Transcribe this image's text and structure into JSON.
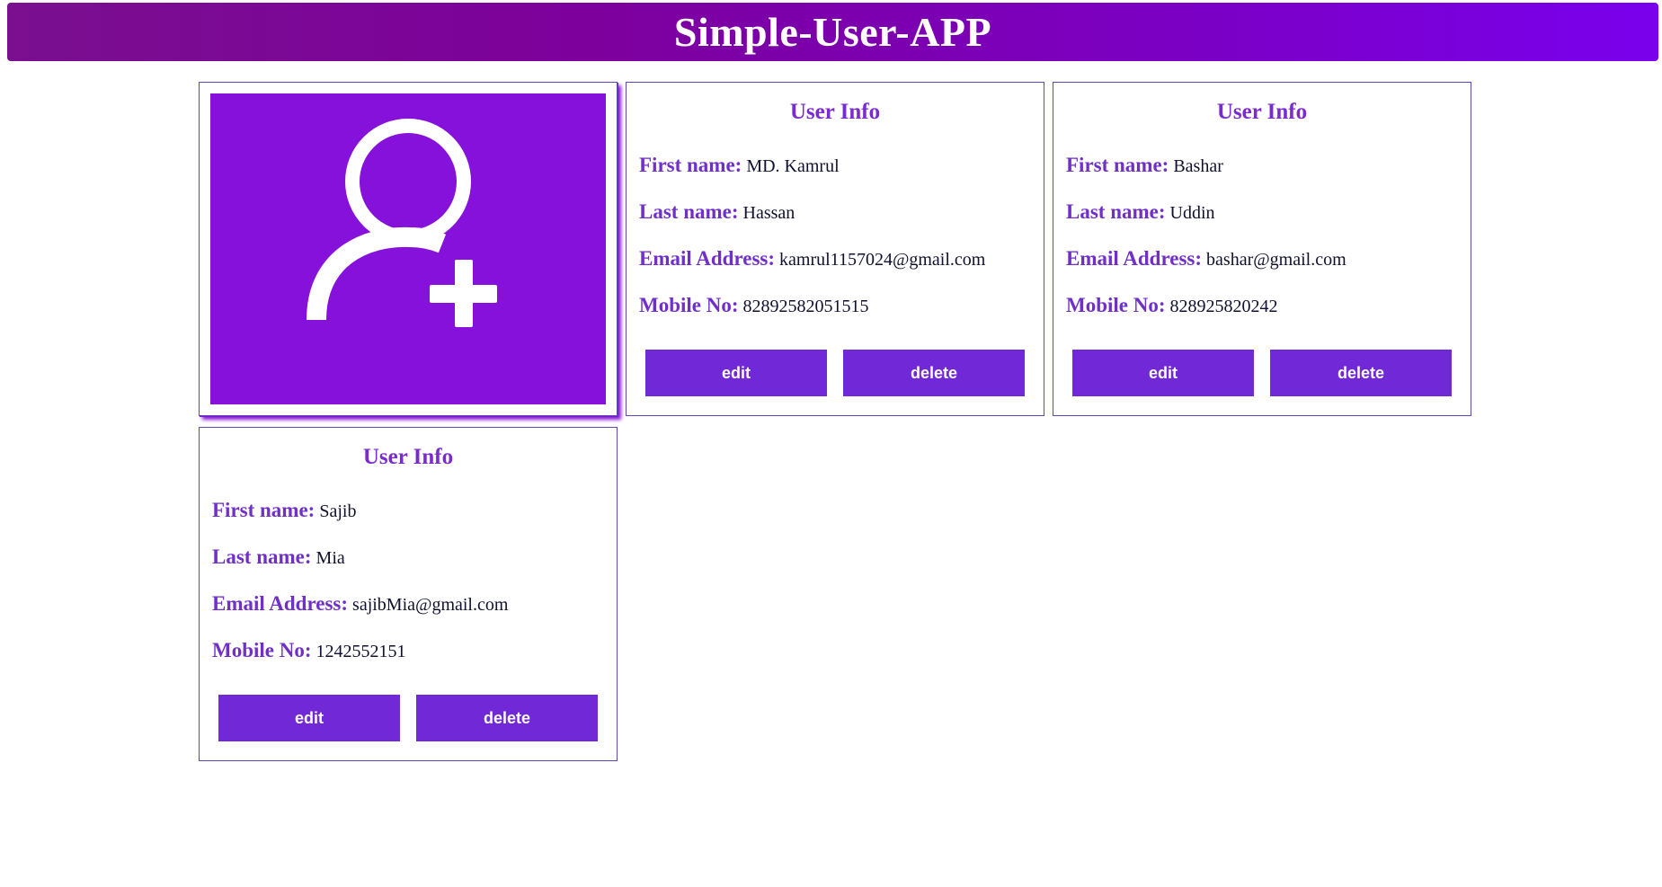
{
  "header": {
    "title": "Simple-User-APP"
  },
  "add_user": {
    "icon": "add-user-icon",
    "tile_color": "#8511db"
  },
  "colors": {
    "accent": "#7128d6",
    "label": "#7030c8",
    "header_start": "#7a0f8f",
    "header_end": "#7a00ee"
  },
  "users": [
    {
      "card_title": "User Info",
      "first_name_label": "First name:",
      "first_name": "MD. Kamrul",
      "last_name_label": "Last name:",
      "last_name": "Hassan",
      "email_label": "Email Address:",
      "email": "kamrul1157024@gmail.com",
      "mobile_label": "Mobile No:",
      "mobile": "82892582051515",
      "edit_label": "edit",
      "delete_label": "delete"
    },
    {
      "card_title": "User Info",
      "first_name_label": "First name:",
      "first_name": "Bashar",
      "last_name_label": "Last name:",
      "last_name": "Uddin",
      "email_label": "Email Address:",
      "email": "bashar@gmail.com",
      "mobile_label": "Mobile No:",
      "mobile": "828925820242",
      "edit_label": "edit",
      "delete_label": "delete"
    },
    {
      "card_title": "User Info",
      "first_name_label": "First name:",
      "first_name": "Sajib",
      "last_name_label": "Last name:",
      "last_name": "Mia",
      "email_label": "Email Address:",
      "email": "sajibMia@gmail.com",
      "mobile_label": "Mobile No:",
      "mobile": "1242552151",
      "edit_label": "edit",
      "delete_label": "delete"
    }
  ]
}
